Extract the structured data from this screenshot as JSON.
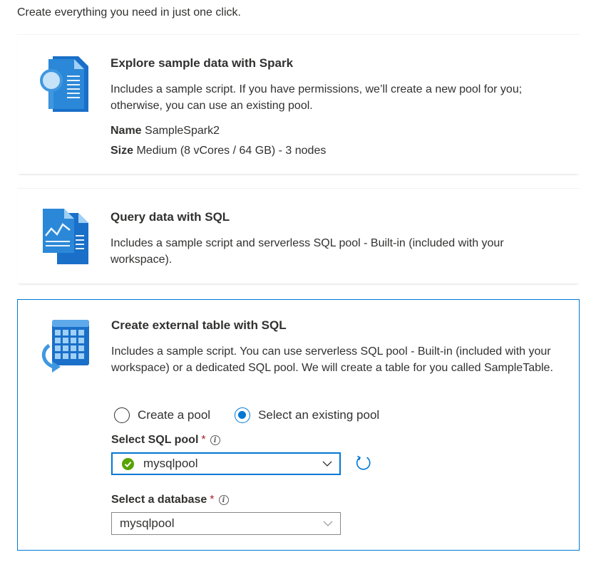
{
  "intro": "Create everything you need in just one click.",
  "cards": [
    {
      "title": "Explore sample data with Spark",
      "description": "Includes a sample script. If you have permissions, we’ll create a new pool for you; otherwise, you can use an existing pool.",
      "name_label": "Name",
      "name_value": "SampleSpark2",
      "size_label": "Size",
      "size_value": "Medium (8 vCores / 64 GB) - 3 nodes",
      "icon": "document-search-icon"
    },
    {
      "title": "Query data with SQL",
      "description": "Includes a sample script and serverless SQL pool - Built-in (included with your workspace).",
      "icon": "documents-chart-icon"
    },
    {
      "title": "Create external table with SQL",
      "description": "Includes a sample script. You can use serverless SQL pool - Built-in (included with your workspace) or a dedicated SQL pool. We will create a table for you called SampleTable.",
      "icon": "table-arrow-icon",
      "options": {
        "create_pool": "Create a pool",
        "select_existing": "Select an existing pool",
        "selected": "select_existing"
      },
      "sql_pool": {
        "label": "Select SQL pool",
        "required": "*",
        "value": "mysqlpool"
      },
      "database": {
        "label": "Select a database",
        "required": "*",
        "value": "mysqlpool"
      }
    }
  ],
  "colors": {
    "accent": "#0078d4",
    "required": "#a4262c",
    "success": "#57a300",
    "text": "#323130"
  }
}
